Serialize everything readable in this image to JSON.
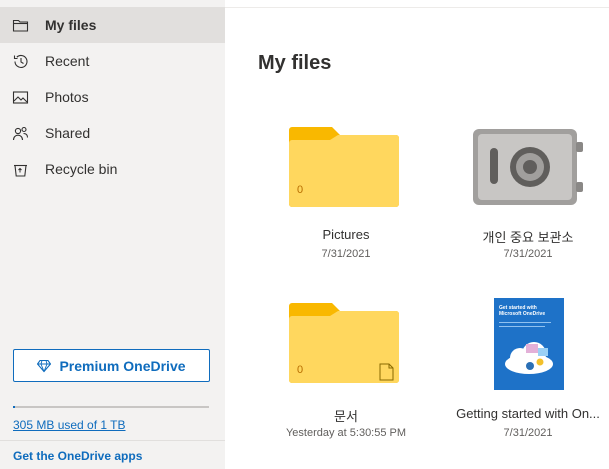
{
  "sidebar": {
    "items": [
      {
        "label": "My files",
        "icon": "folder-icon",
        "active": true
      },
      {
        "label": "Recent",
        "icon": "recent-icon"
      },
      {
        "label": "Photos",
        "icon": "photos-icon"
      },
      {
        "label": "Shared",
        "icon": "shared-icon"
      },
      {
        "label": "Recycle bin",
        "icon": "recycle-bin-icon"
      }
    ],
    "premium_label": "Premium OneDrive",
    "premium_icon": "diamond-icon",
    "storage_text": "305 MB used of 1 TB",
    "storage_used_fraction": 0.0003,
    "apps_link": "Get the OneDrive apps"
  },
  "main": {
    "title": "My files",
    "items": [
      {
        "name": "Pictures",
        "date": "7/31/2021",
        "type": "folder",
        "count": "0"
      },
      {
        "name": "개인 중요 보관소",
        "date": "7/31/2021",
        "type": "vault"
      },
      {
        "name": "문서",
        "date": "Yesterday at 5:30:55 PM",
        "type": "folder",
        "count": "0"
      },
      {
        "name": "Getting started with On...",
        "date": "7/31/2021",
        "type": "document",
        "thumb_title": "Get started with Microsoft OneDrive"
      }
    ]
  },
  "colors": {
    "accent": "#0f6cbd",
    "sidebar_bg": "#f3f2f1",
    "active_bg": "#e1dfdd",
    "folder_front": "#ffd75e",
    "folder_back": "#f9b800",
    "doc_blue": "#1e72c8"
  }
}
